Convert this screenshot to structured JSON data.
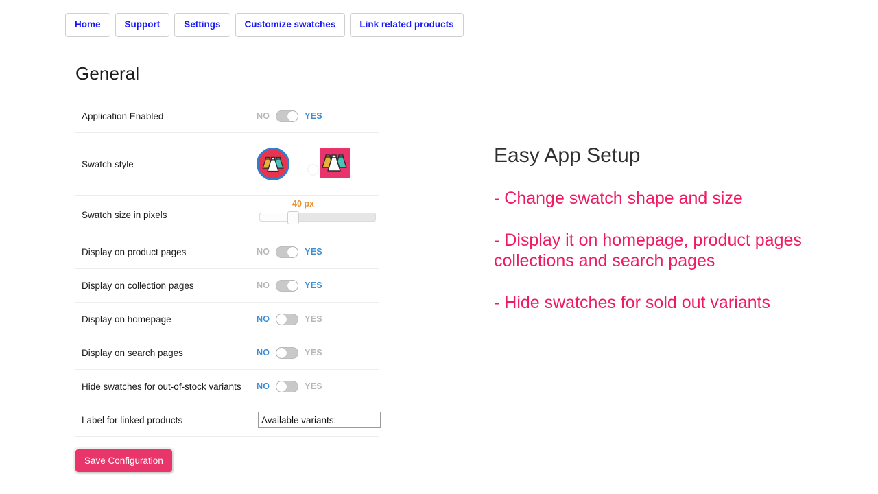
{
  "nav": {
    "buttons": [
      {
        "label": "Home"
      },
      {
        "label": "Support"
      },
      {
        "label": "Settings"
      },
      {
        "label": "Customize swatches"
      },
      {
        "label": "Link related products"
      }
    ]
  },
  "form": {
    "title": "General",
    "toggle_labels": {
      "off": "NO",
      "on": "YES"
    },
    "rows": {
      "application_enabled": {
        "label": "Application Enabled",
        "value": "YES"
      },
      "swatch_style": {
        "label": "Swatch style",
        "selected": "circle"
      },
      "swatch_size": {
        "label": "Swatch size in pixels",
        "value": "40 px",
        "number": 40,
        "percent": 24
      },
      "display_product_pages": {
        "label": "Display on product pages",
        "value": "YES"
      },
      "display_collection_pages": {
        "label": "Display on collection pages",
        "value": "YES"
      },
      "display_homepage": {
        "label": "Display on homepage",
        "value": "NO"
      },
      "display_search_pages": {
        "label": "Display on search pages",
        "value": "NO"
      },
      "hide_out_of_stock": {
        "label": "Hide swatches for out-of-stock variants",
        "value": "NO"
      },
      "label_linked_products": {
        "label": "Label for linked products",
        "value": "Available variants:",
        "placeholder": "Available variants:"
      }
    },
    "save_label": "Save Configuration"
  },
  "promo": {
    "title": "Easy App Setup",
    "items": [
      "- Change swatch shape and size",
      "- Display it on homepage, product pages\n   collections and search pages",
      "- Hide swatches for sold out variants"
    ]
  },
  "colors": {
    "nav_text": "#1818ff",
    "toggle_on_text": "#3a8fd6",
    "toggle_off_text": "#b7b7b7",
    "slider_value": "#e8912f",
    "save_button": "#e8366b",
    "promo_text": "#ef1a5f",
    "promo_title": "#303030",
    "swatch_ring": "#2f7fd0",
    "swatch_circle_bg": "#e8344f",
    "swatch_square_bg": "#e8346a"
  }
}
